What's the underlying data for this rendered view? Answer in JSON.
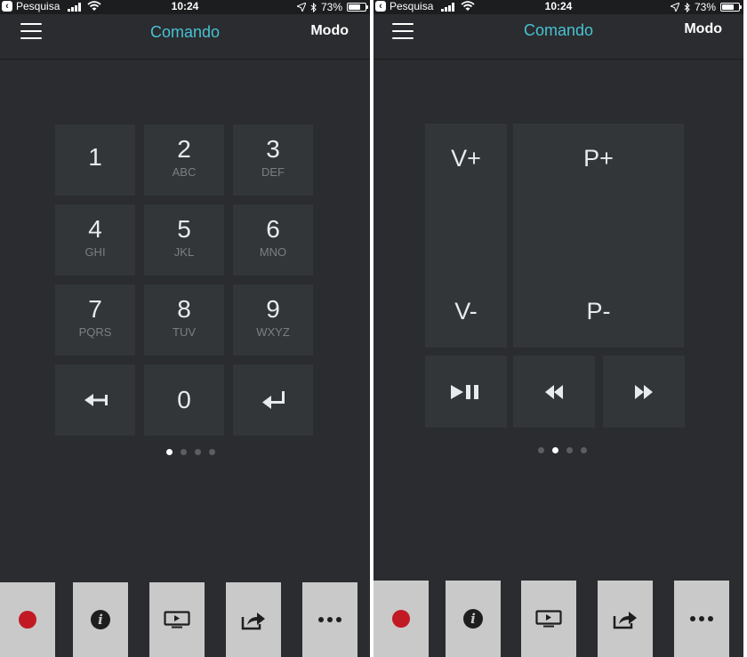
{
  "status_bar": {
    "back_app": "Pesquisa",
    "time": "10:24",
    "battery_percent": "73%",
    "battery_level": 0.73
  },
  "nav": {
    "title": "Comando",
    "mode": "Modo"
  },
  "keypad": {
    "keys": [
      {
        "digit": "1",
        "letters": ""
      },
      {
        "digit": "2",
        "letters": "ABC"
      },
      {
        "digit": "3",
        "letters": "DEF"
      },
      {
        "digit": "4",
        "letters": "GHI"
      },
      {
        "digit": "5",
        "letters": "JKL"
      },
      {
        "digit": "6",
        "letters": "MNO"
      },
      {
        "digit": "7",
        "letters": "PQRS"
      },
      {
        "digit": "8",
        "letters": "TUV"
      },
      {
        "digit": "9",
        "letters": "WXYZ"
      },
      {
        "digit": "0",
        "letters": ""
      }
    ],
    "page_active": 1,
    "page_count": 4
  },
  "remote": {
    "volume_up": "V+",
    "volume_down": "V-",
    "channel_up": "P+",
    "channel_down": "P-",
    "page_active": 2,
    "page_count": 4
  },
  "toolbar": {
    "icons": [
      "record-icon",
      "info-icon",
      "screen-icon",
      "share-icon",
      "more-icon"
    ],
    "info_glyph": "i"
  },
  "colors": {
    "accent": "#48c1d3",
    "background": "#2a2c2f",
    "key": "#323639",
    "record": "#c21a24",
    "toolbar": "#c9c9c9"
  }
}
